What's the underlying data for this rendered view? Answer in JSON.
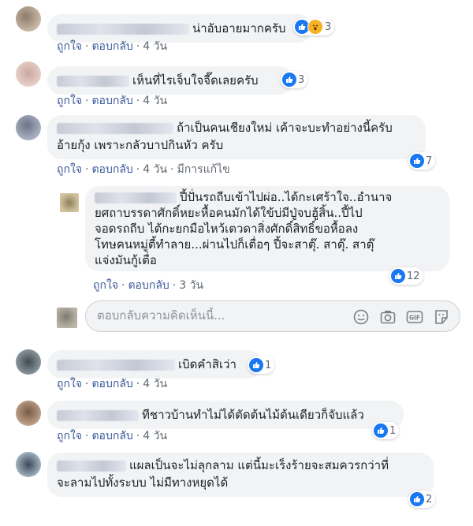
{
  "actions": {
    "like": "ถูกใจ",
    "reply": "ตอบกลับ",
    "edited": "มีการแก้ไข"
  },
  "comments": [
    {
      "text": "น่าอับอายมากครับ",
      "time": "4 วัน",
      "count": "3"
    },
    {
      "text": "เห็นที่ไรเจ็บใจจี๊ดเลยครับ",
      "time": "4 วัน",
      "count": "3"
    },
    {
      "text_l1": "ถ้าเป็นคนเชียงใหม่ เค้าจะบะทำอย่างนี้ครับ",
      "text_l2": "อ้ายกุ้ง เพราะกลัวบาปกินหัว ครับ",
      "time": "4 วัน",
      "count": "7"
    },
    {
      "text_l1": "ปี้ปั่นรถถีบเข้าไปผ่อ..ได้กะเศร้าใจ..อำนาจ",
      "text_l2": "ยศถาบรรดาศักดิ์หยะหื้อคนมักได้ใข้บ่มีปู่จบฮู้สิ้น..ปี้ไป",
      "text_l3": "จอดรถถีบ ไต้กะยกมือไหว้เตวดาสิ่งศักดิ์สิทธิ์ขอหื้อลง",
      "text_l4": "โทษคนหมู่ตี้ทำลาย...ผ่านไปก็เตื่อๆ ปี้จะสาตุ๊. สาตุ๊. สาตุ๊",
      "text_l5": "แจ่งมันกู้เตื่อ",
      "time": "3 วัน",
      "count": "12"
    },
    {
      "text": "เบิดคำสิเว่า",
      "time": "4 วัน",
      "count": "1"
    },
    {
      "text": "ทีชาวบ้านทำไม่ได้ตัดต้นไม้ต้นเดียวก็จับแล้ว",
      "time": "4 วัน",
      "count": "1"
    },
    {
      "text_l1": "แผลเป็นจะไม่ลุกลาม แต่นี้มะเร็งร้ายจะสมควรกว่าที่",
      "text_l2": "จะลามไปทั้งระบบ ไม่มีทางหยุดได้",
      "time": "4 วัน",
      "count": "2"
    }
  ],
  "reply_box": {
    "placeholder": "ตอบกลับความคิดเห็นนี้..."
  },
  "icons": [
    "like-reaction-icon",
    "wow-reaction-icon",
    "emoji-icon",
    "camera-icon",
    "gif-icon",
    "sticker-icon"
  ],
  "colors": {
    "link": "#385898",
    "like_blue": "#1877f2",
    "bubble": "#f2f3f5"
  }
}
